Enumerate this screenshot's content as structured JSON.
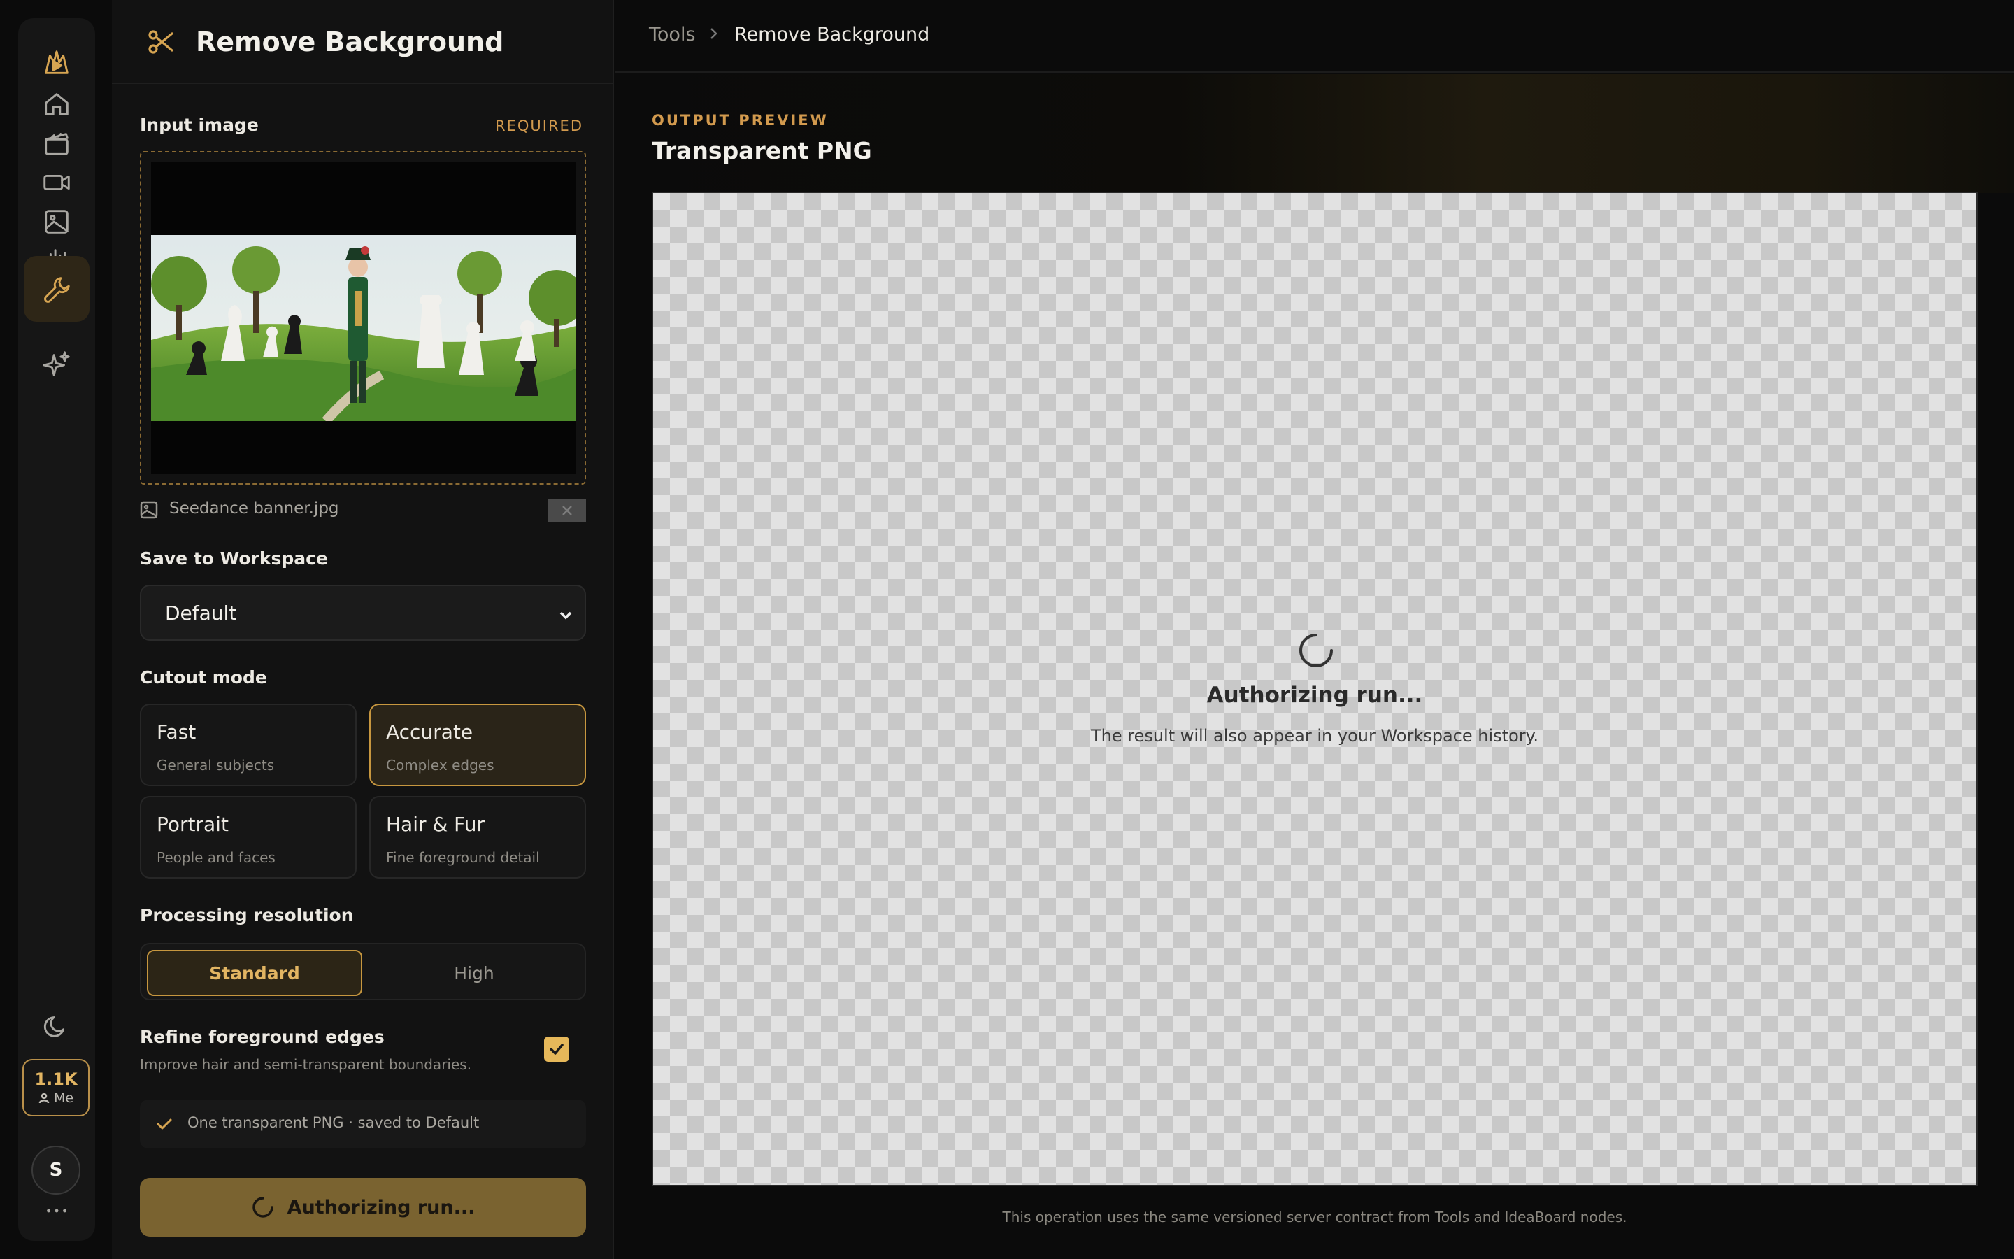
{
  "rail": {
    "items": [
      {
        "icon": "home-icon"
      },
      {
        "icon": "clapperboard-icon"
      },
      {
        "icon": "video-camera-icon"
      },
      {
        "icon": "image-icon"
      },
      {
        "icon": "audio-waveform-icon"
      },
      {
        "icon": "wrench-icon",
        "active": true
      },
      {
        "icon": "sparkles-icon"
      }
    ],
    "credits": "1.1K",
    "credits_owner": "Me",
    "avatar_initial": "S"
  },
  "panel": {
    "title": "Remove Background",
    "input_label": "Input image",
    "input_required": "REQUIRED",
    "file_name": "Seedance banner.jpg",
    "workspace_label": "Save to Workspace",
    "workspace_value": "Default",
    "cutout_label": "Cutout mode",
    "modes": [
      {
        "title": "Fast",
        "sub": "General subjects",
        "selected": false
      },
      {
        "title": "Accurate",
        "sub": "Complex edges",
        "selected": true
      },
      {
        "title": "Portrait",
        "sub": "People and faces",
        "selected": false
      },
      {
        "title": "Hair & Fur",
        "sub": "Fine foreground detail",
        "selected": false
      }
    ],
    "resolution_label": "Processing resolution",
    "resolution_options": [
      "Standard",
      "High"
    ],
    "resolution_selected": "Standard",
    "refine_title": "Refine foreground edges",
    "refine_sub": "Improve hair and semi-transparent boundaries.",
    "refine_checked": true,
    "summary": "One transparent PNG · saved to Default",
    "run_label": "Authorizing run..."
  },
  "breadcrumb": {
    "root": "Tools",
    "current": "Remove Background"
  },
  "preview": {
    "eyebrow": "OUTPUT PREVIEW",
    "title": "Transparent PNG",
    "status_title": "Authorizing run...",
    "status_sub": "The result will also appear in your Workspace history."
  },
  "footnote": "This operation uses the same versioned server contract from Tools and IdeaBoard nodes.",
  "colors": {
    "accent": "#d7a552",
    "accent_dim": "#7a6330",
    "background": "#0b0b0b",
    "panel": "#121212"
  }
}
